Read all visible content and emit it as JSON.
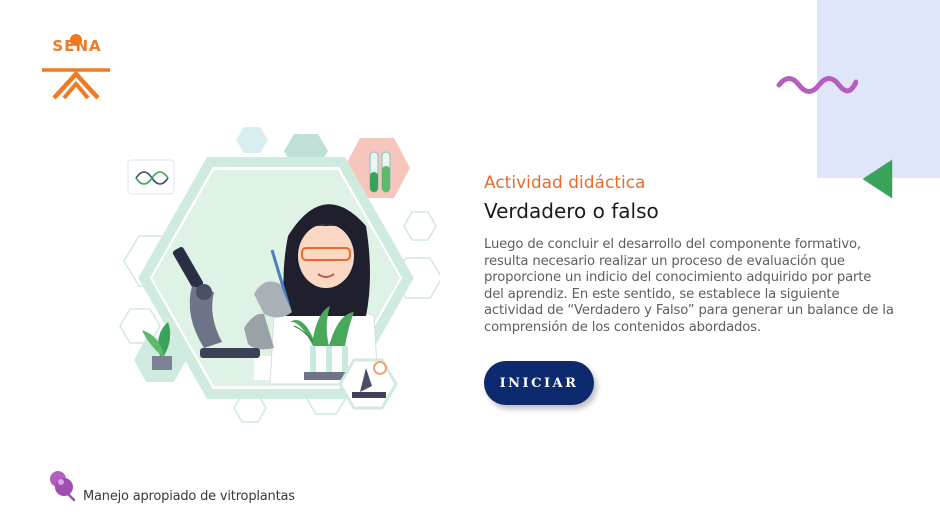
{
  "logo": {
    "text": "SENA"
  },
  "activity": {
    "subtitle": "Actividad didáctica",
    "title": "Verdadero o falso",
    "description": "Luego de concluir el desarrollo del componente formativo, resulta necesario realizar un proceso de evaluación que proporcione un indicio del conocimiento adquirido por parte del aprendiz.  En este sentido, se establece la siguiente actividad de “Verdadero y Falso” para generar un balance de la comprensión de los contenidos abordados."
  },
  "start_button": {
    "label": "INICIAR"
  },
  "footer": {
    "label": "Manejo apropiado de vitroplantas",
    "icon": "plant-cell-icon"
  },
  "colors": {
    "accent_orange": "#e96b2b",
    "button_navy": "#0e2a6e",
    "panel_blue": "#dfe6fb",
    "wave_purple": "#b45fc0",
    "triangle_green": "#3aa35a"
  }
}
